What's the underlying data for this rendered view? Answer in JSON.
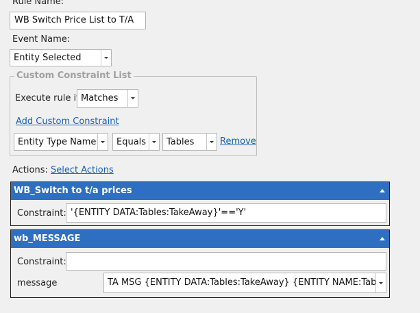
{
  "rule_name": {
    "label": "Rule Name:",
    "value": "WB Switch Price List to T/A"
  },
  "event_name": {
    "label": "Event Name:",
    "value": "Entity Selected"
  },
  "custom_constraints": {
    "title": "Custom Constraint List",
    "execute_label": "Execute rule if",
    "execute_value": "Matches",
    "add_link": "Add Custom Constraint",
    "row": {
      "field": "Entity Type Name",
      "operator": "Equals",
      "value": "Tables",
      "remove": "Remove"
    }
  },
  "actions": {
    "label": "Actions:",
    "select_link": "Select Actions",
    "items": [
      {
        "title": "WB_Switch to t/a prices",
        "constraint_label": "Constraint:",
        "constraint_value": "'{ENTITY DATA:Tables:TakeAway}'=='Y'"
      },
      {
        "title": "wb_MESSAGE",
        "constraint_label": "Constraint:",
        "constraint_value": "",
        "message_label": "message",
        "message_value": "TA MSG {ENTITY DATA:Tables:TakeAway} {ENTITY NAME:Tables}"
      }
    ]
  },
  "colors": {
    "header": "#2f6fc1",
    "link": "#1a5fb4",
    "background": "#f0f0f0"
  }
}
